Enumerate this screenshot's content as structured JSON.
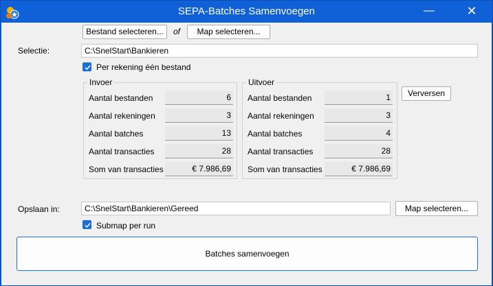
{
  "window": {
    "title": "SEPA-Batches Samenvoegen",
    "minimize_glyph": "—",
    "close_glyph": "✕"
  },
  "source": {
    "select_file_label": "Bestand selecteren...",
    "or_label": "of",
    "select_folder_label": "Map selecteren..."
  },
  "selection": {
    "label": "Selectie:",
    "path": "C:\\SnelStart\\Bankieren",
    "per_account_label": "Per rekening één bestand",
    "per_account_checked": true
  },
  "input_group": {
    "title": "Invoer",
    "rows": [
      {
        "label": "Aantal bestanden",
        "value": "6"
      },
      {
        "label": "Aantal rekeningen",
        "value": "3"
      },
      {
        "label": "Aantal batches",
        "value": "13"
      },
      {
        "label": "Aantal transacties",
        "value": "28"
      },
      {
        "label": "Som van transacties",
        "value": "€ 7.986,69"
      }
    ]
  },
  "output_group": {
    "title": "Uitvoer",
    "rows": [
      {
        "label": "Aantal bestanden",
        "value": "1"
      },
      {
        "label": "Aantal rekeningen",
        "value": "3"
      },
      {
        "label": "Aantal batches",
        "value": "4"
      },
      {
        "label": "Aantal transacties",
        "value": "28"
      },
      {
        "label": "Som van transacties",
        "value": "€ 7.986,69"
      }
    ]
  },
  "refresh_label": "Verversen",
  "save": {
    "label": "Opslaan in:",
    "path": "C:\\SnelStart\\Bankieren\\Gereed",
    "select_folder_label": "Map selecteren...",
    "subfolder_label": "Submap per run",
    "subfolder_checked": true
  },
  "merge_button_label": "Batches samenvoegen",
  "colors": {
    "titlebar": "#1060d8",
    "accent": "#1a6fd6",
    "background": "#f0f0f0"
  }
}
